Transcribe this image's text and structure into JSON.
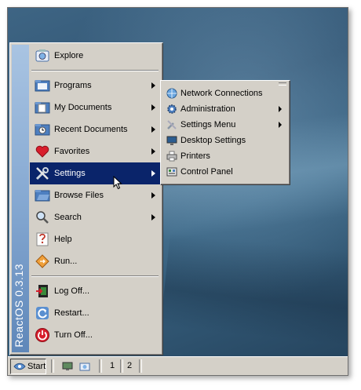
{
  "branding": {
    "text": "ReactOS  0.3.13"
  },
  "start_menu": {
    "items": [
      {
        "label": "Explore",
        "icon": "explore-icon",
        "submenu": false
      },
      {
        "label": "Programs",
        "icon": "programs-folder-icon",
        "submenu": true
      },
      {
        "label": "My Documents",
        "icon": "documents-folder-icon",
        "submenu": true
      },
      {
        "label": "Recent Documents",
        "icon": "recent-documents-icon",
        "submenu": true
      },
      {
        "label": "Favorites",
        "icon": "favorites-heart-icon",
        "submenu": true
      },
      {
        "label": "Settings",
        "icon": "settings-tools-icon",
        "submenu": true,
        "selected": true
      },
      {
        "label": "Browse Files",
        "icon": "browse-folder-icon",
        "submenu": true
      },
      {
        "label": "Search",
        "icon": "search-icon",
        "submenu": true
      },
      {
        "label": "Help",
        "icon": "help-icon",
        "submenu": false
      },
      {
        "label": "Run...",
        "icon": "run-icon",
        "submenu": false
      },
      {
        "label": "Log Off...",
        "icon": "logoff-icon",
        "submenu": false
      },
      {
        "label": "Restart...",
        "icon": "restart-icon",
        "submenu": false
      },
      {
        "label": "Turn Off...",
        "icon": "power-icon",
        "submenu": false
      }
    ]
  },
  "settings_submenu": {
    "items": [
      {
        "label": "Network Connections",
        "icon": "network-icon",
        "submenu": false
      },
      {
        "label": "Administration",
        "icon": "administration-gear-icon",
        "submenu": true
      },
      {
        "label": "Settings Menu",
        "icon": "settings-menu-icon",
        "submenu": true
      },
      {
        "label": "Desktop Settings",
        "icon": "desktop-settings-icon",
        "submenu": false
      },
      {
        "label": "Printers",
        "icon": "printer-icon",
        "submenu": false
      },
      {
        "label": "Control Panel",
        "icon": "control-panel-icon",
        "submenu": false
      }
    ]
  },
  "taskbar": {
    "start_label": "Start",
    "workspaces": [
      "1",
      "2"
    ]
  },
  "colors": {
    "menu_bg": "#d4d0c8",
    "selection": "#0a246a",
    "brand_bar": "#86a9d2"
  }
}
